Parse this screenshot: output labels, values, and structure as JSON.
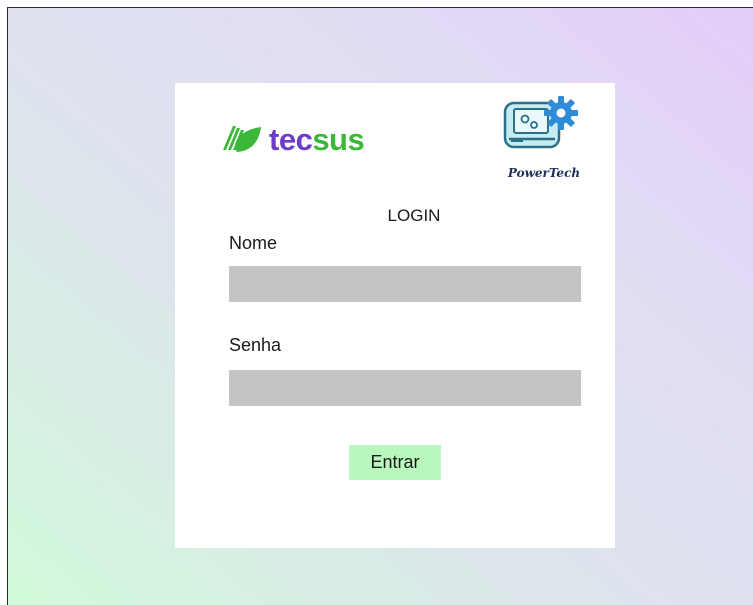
{
  "brand": {
    "left_logo_text_a": "tec",
    "left_logo_text_b": "sus",
    "left_logo_icon": "leaf-stripes-icon",
    "right_logo_text": "PowerTech",
    "right_logo_icon": "laptop-gears-icon"
  },
  "login": {
    "title": "LOGIN",
    "nome_label": "Nome",
    "nome_value": "",
    "senha_label": "Senha",
    "senha_value": "",
    "submit_label": "Entrar"
  },
  "colors": {
    "brand_purple": "#6a3cc8",
    "brand_green": "#3cb839",
    "input_bg": "#c4c4c4",
    "button_bg": "#baf7bc"
  }
}
